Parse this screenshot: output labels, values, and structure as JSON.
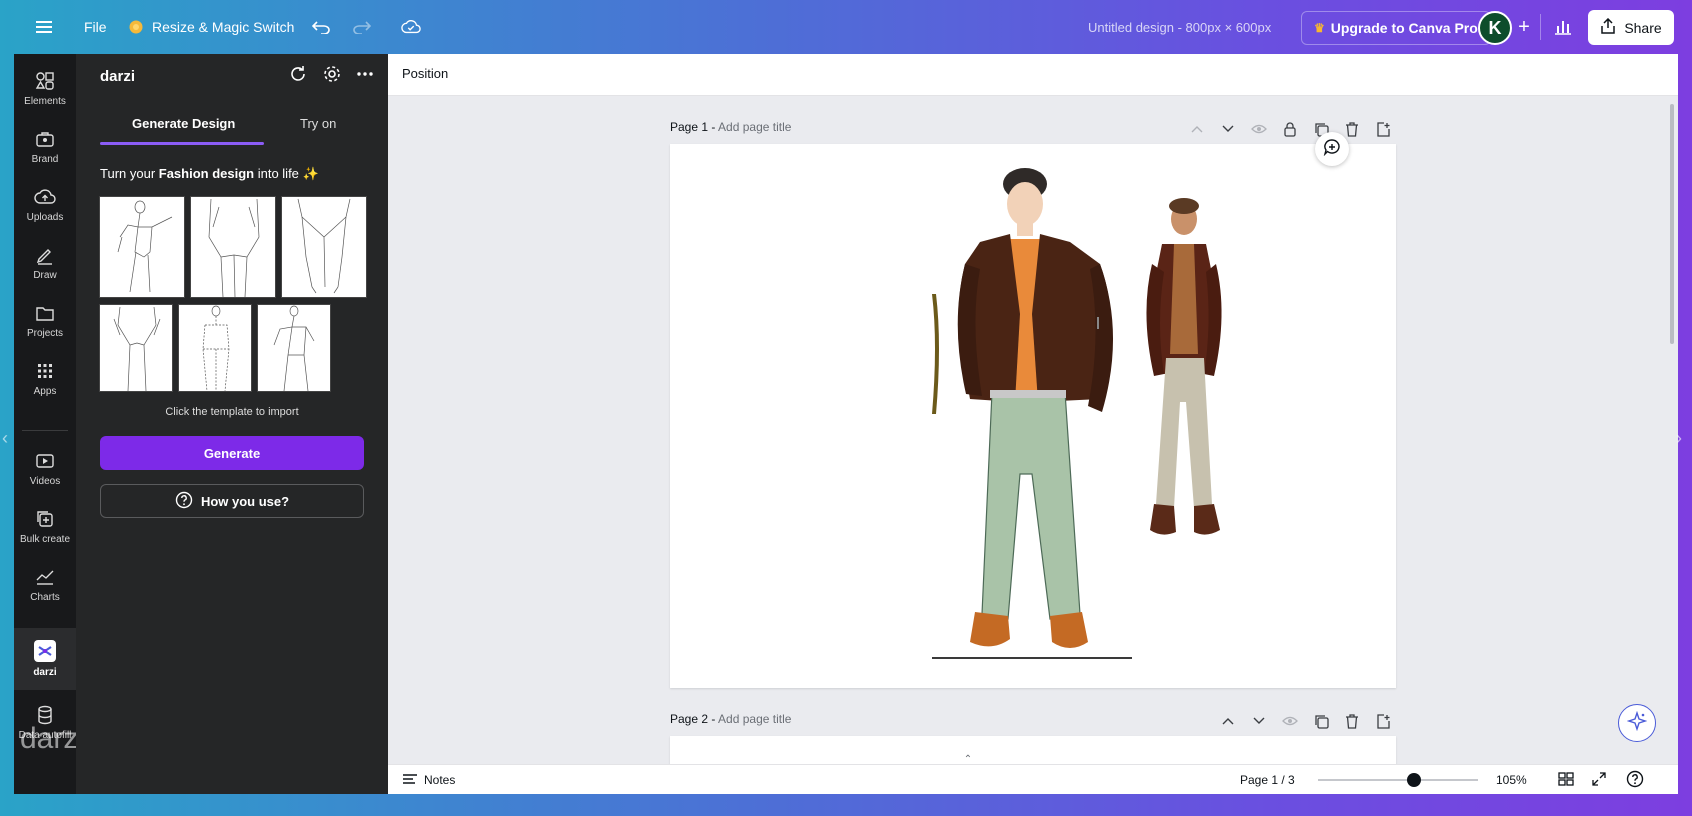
{
  "topbar": {
    "menu_icon": "hamburger-icon",
    "file_label": "File",
    "resize_label": "Resize & Magic Switch",
    "design_title": "Untitled design - 800px × 600px",
    "upgrade_label": "Upgrade to Canva Pro",
    "avatar_initial": "K",
    "share_label": "Share"
  },
  "rail": {
    "items": [
      {
        "label": "Elements",
        "icon": "elements-icon"
      },
      {
        "label": "Brand",
        "icon": "brand-icon"
      },
      {
        "label": "Uploads",
        "icon": "upload-icon"
      },
      {
        "label": "Draw",
        "icon": "draw-icon"
      },
      {
        "label": "Projects",
        "icon": "folder-icon"
      },
      {
        "label": "Apps",
        "icon": "apps-icon"
      },
      {
        "label": "Videos",
        "icon": "video-icon"
      },
      {
        "label": "Bulk create",
        "icon": "bulk-create-icon"
      },
      {
        "label": "Charts",
        "icon": "chart-icon"
      },
      {
        "label": "darzi",
        "icon": "darzi-app-icon"
      },
      {
        "label": "Data autofill",
        "icon": "database-icon"
      }
    ],
    "watermark": "darzi"
  },
  "panel": {
    "title": "darzi",
    "tabs": [
      "Generate Design",
      "Try on"
    ],
    "tagline_pre": "Turn your ",
    "tagline_bold": "Fashion design",
    "tagline_post": " into life ✨",
    "import_hint": "Click the template to import",
    "generate_label": "Generate",
    "how_label": "How you use?"
  },
  "toolbar": {
    "position_label": "Position"
  },
  "pages": [
    {
      "prefix": "Page 1 - ",
      "placeholder": "Add page title"
    },
    {
      "prefix": "Page 2 - ",
      "placeholder": "Add page title"
    }
  ],
  "bottombar": {
    "notes_label": "Notes",
    "page_indicator": "Page 1 / 3",
    "zoom_level": "105%",
    "zoom_fraction": 0.6
  },
  "colors": {
    "accent": "#7d2ae8",
    "panel_bg": "#252627",
    "rail_bg": "#18191b",
    "canvas_bg": "#eaebef"
  }
}
